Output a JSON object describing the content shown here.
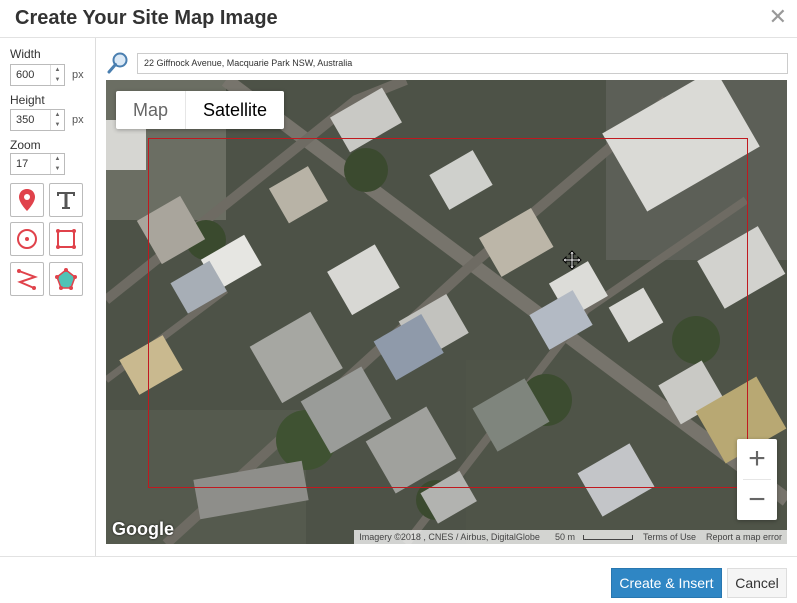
{
  "dialog": {
    "title": "Create Your Site Map Image",
    "close_icon": "close-icon"
  },
  "sidebar": {
    "width": {
      "label": "Width",
      "value": "600",
      "unit": "px"
    },
    "height": {
      "label": "Height",
      "value": "350",
      "unit": "px"
    },
    "zoom": {
      "label": "Zoom",
      "value": "17"
    },
    "tools": [
      "marker-tool-icon",
      "text-tool-icon",
      "circle-tool-icon",
      "rectangle-tool-icon",
      "line-tool-icon",
      "polygon-tool-icon"
    ]
  },
  "search": {
    "icon": "search-icon",
    "address": "22 Giffnock Avenue, Macquarie Park NSW, Australia"
  },
  "map": {
    "type_buttons": [
      "Map",
      "Satellite"
    ],
    "active_type": "Satellite",
    "zoom_in": "+",
    "zoom_out": "−",
    "logo": "Google",
    "attribution": "Imagery ©2018 , CNES / Airbus, DigitalGlobe",
    "scale": "50 m",
    "terms": "Terms of Use",
    "report": "Report a map error",
    "selection_color": "#c0191f"
  },
  "footer": {
    "primary": "Create & Insert",
    "cancel": "Cancel",
    "primary_color": "#2f86c4"
  }
}
